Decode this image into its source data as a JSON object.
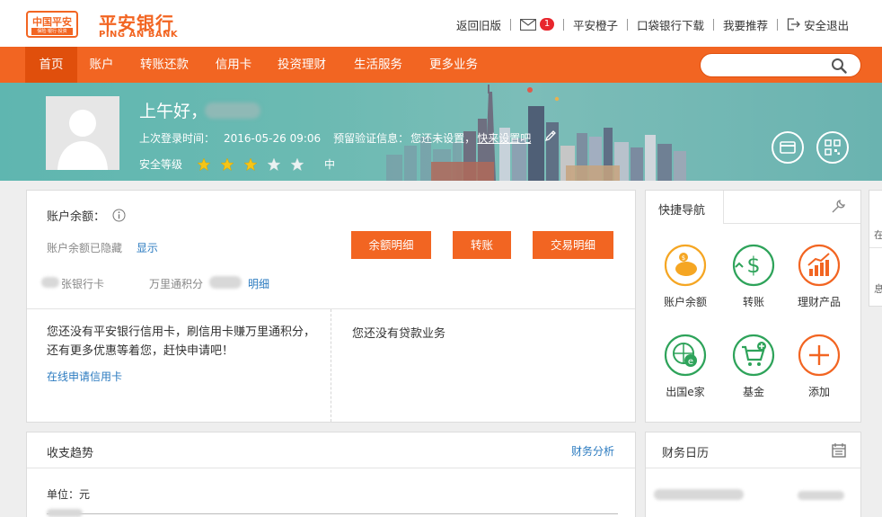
{
  "brand": {
    "logo_text": "中国平安",
    "logo_sub": "保险·银行·投资",
    "name_cn": "平安银行",
    "name_en": "PING AN BANK",
    "accent": "#f26522"
  },
  "top_links": {
    "old_version": "返回旧版",
    "mail_count": "1",
    "orange": "平安橙子",
    "pocket": "口袋银行下载",
    "recommend": "我要推荐",
    "logout": "安全退出"
  },
  "nav": {
    "items": [
      "首页",
      "账户",
      "转账还款",
      "信用卡",
      "投资理财",
      "生活服务",
      "更多业务"
    ],
    "search_placeholder": ""
  },
  "banner": {
    "greeting": "上午好，",
    "last_login_label": "上次登录时间：",
    "last_login_time": "2016-05-26 09:06",
    "verify_label": "预留验证信息：",
    "verify_value": "您还未设置，",
    "verify_link": "快来设置吧",
    "safety_label": "安全等级",
    "safety_stars": 3,
    "safety_total": 5,
    "safety_level": "中"
  },
  "account": {
    "balance_label": "账户余额：",
    "hidden_text": "账户余额已隐藏",
    "show_link": "显示",
    "btn_detail": "余额明细",
    "btn_transfer": "转账",
    "btn_trade": "交易明细",
    "cards_text": "张银行卡",
    "points_label": "万里通积分",
    "points_link": "明细"
  },
  "credit": {
    "no_card_text": "您还没有平安银行信用卡，刷信用卡赚万里通积分，还有更多优惠等着您，赶快申请吧！",
    "apply_link": "在线申请信用卡",
    "no_loan_text": "您还没有贷款业务"
  },
  "quick_nav": {
    "title": "快捷导航",
    "items": [
      "账户余额",
      "转账",
      "理财产品",
      "出国e家",
      "基金",
      "添加"
    ]
  },
  "trend": {
    "title": "收支趋势",
    "analysis_link": "财务分析",
    "unit_label": "单位：元"
  },
  "calendar": {
    "title": "财务日历"
  },
  "right_edge": {
    "label1": "在",
    "label2": "息"
  }
}
